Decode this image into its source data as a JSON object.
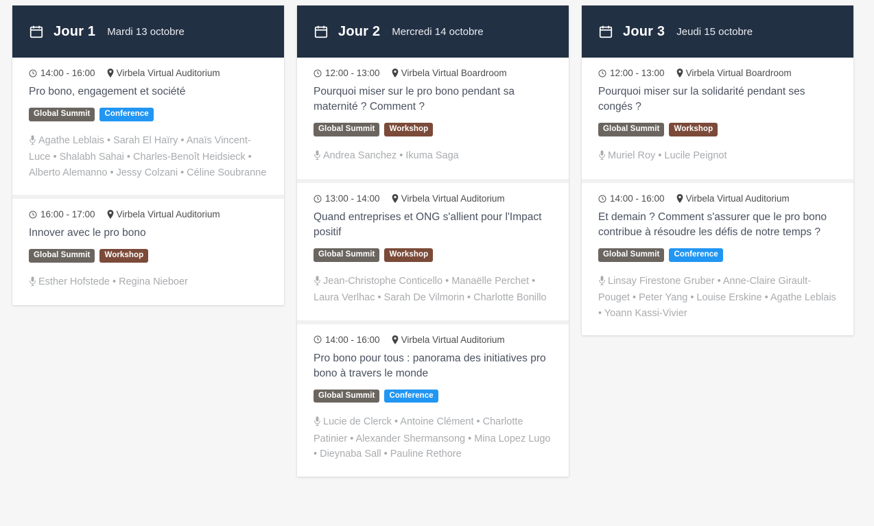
{
  "page": {
    "background_color": "#f6f6f7",
    "header_color": "#223044",
    "tag_colors": {
      "Global Summit": "#6b6560",
      "Conference": "#2196f3",
      "Workshop": "#7b4a39"
    }
  },
  "days": [
    {
      "icon": "calendar-icon",
      "label": "Jour 1",
      "date": "Mardi 13 octobre",
      "sessions": [
        {
          "time": "14:00 - 16:00",
          "location": "Virbela Virtual Auditorium",
          "title": "Pro bono, engagement et société",
          "tags": [
            "Global Summit",
            "Conference"
          ],
          "speakers": "Agathe Leblais • Sarah El Haïry • Anaïs Vincent-Luce • Shalabh Sahai • Charles-Benoît Heidsieck • Alberto Alemanno • Jessy Colzani • Céline Soubranne"
        },
        {
          "time": "16:00 - 17:00",
          "location": "Virbela Virtual Auditorium",
          "title": "Innover avec le pro bono",
          "tags": [
            "Global Summit",
            "Workshop"
          ],
          "speakers": "Esther Hofstede • Regina Nieboer"
        }
      ]
    },
    {
      "icon": "calendar-icon",
      "label": "Jour 2",
      "date": "Mercredi 14 octobre",
      "sessions": [
        {
          "time": "12:00 - 13:00",
          "location": "Virbela Virtual Boardroom",
          "title": "Pourquoi miser sur le pro bono pendant sa maternité ? Comment ?",
          "tags": [
            "Global Summit",
            "Workshop"
          ],
          "speakers": "Andrea Sanchez • Ikuma Saga"
        },
        {
          "time": "13:00 - 14:00",
          "location": "Virbela Virtual Auditorium",
          "title": "Quand entreprises et ONG s'allient pour l'Impact positif",
          "tags": [
            "Global Summit",
            "Workshop"
          ],
          "speakers": "Jean-Christophe Conticello • Manaëlle Perchet • Laura Verlhac • Sarah De Vilmorin • Charlotte Bonillo"
        },
        {
          "time": "14:00 - 16:00",
          "location": "Virbela Virtual Auditorium",
          "title": "Pro bono pour tous : panorama des initiatives pro bono à travers le monde",
          "tags": [
            "Global Summit",
            "Conference"
          ],
          "speakers": "Lucie de Clerck • Antoine Clément • Charlotte Patinier • Alexander Shermansong • Mina Lopez Lugo • Dieynaba Sall • Pauline Rethore"
        }
      ]
    },
    {
      "icon": "calendar-icon",
      "label": "Jour 3",
      "date": "Jeudi 15 octobre",
      "sessions": [
        {
          "time": "12:00 - 13:00",
          "location": "Virbela Virtual Boardroom",
          "title": "Pourquoi miser sur la solidarité pendant ses congés ?",
          "tags": [
            "Global Summit",
            "Workshop"
          ],
          "speakers": "Muriel Roy • Lucile Peignot"
        },
        {
          "time": "14:00 - 16:00",
          "location": "Virbela Virtual Auditorium",
          "title": "Et demain ? Comment s'assurer que le pro bono contribue à résoudre les défis de notre temps ?",
          "tags": [
            "Global Summit",
            "Conference"
          ],
          "speakers": "Linsay Firestone Gruber • Anne-Claire Girault-Pouget • Peter Yang • Louise Erskine • Agathe Leblais • Yoann Kassi-Vivier"
        }
      ]
    }
  ]
}
